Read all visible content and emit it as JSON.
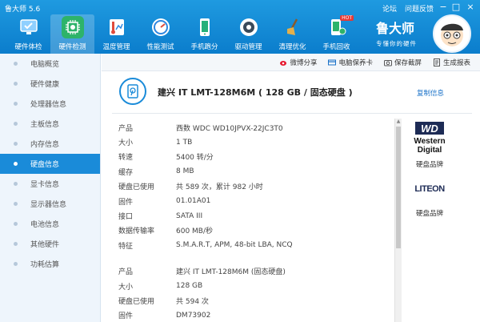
{
  "app": {
    "title": "鲁大师 5.6",
    "links": [
      "论坛",
      "问题反馈"
    ],
    "controls": [
      "−",
      "□",
      "×"
    ]
  },
  "brand": {
    "name": "鲁大师",
    "slogan": "专懂你的硬件"
  },
  "nav": [
    {
      "label": "硬件体检",
      "icon": "monitor-check-icon",
      "color": "#3aa0e8"
    },
    {
      "label": "硬件检测",
      "icon": "chip-icon",
      "color": "#2db36a",
      "active": true
    },
    {
      "label": "温度管理",
      "icon": "thermometer-icon",
      "color": "#e04b3c"
    },
    {
      "label": "性能测试",
      "icon": "speedometer-icon",
      "color": "#2d87e0"
    },
    {
      "label": "手机跑分",
      "icon": "phone-icon",
      "color": "#26b07a"
    },
    {
      "label": "驱动管理",
      "icon": "gear-icon",
      "color": "#3a4a5a"
    },
    {
      "label": "清理优化",
      "icon": "broom-icon",
      "color": "#c98a2a"
    },
    {
      "label": "手机回收",
      "icon": "phone-recycle-icon",
      "color": "#2db36a",
      "badge": "HOT"
    }
  ],
  "sidebar": [
    {
      "label": "电脑概览"
    },
    {
      "label": "硬件健康"
    },
    {
      "label": "处理器信息"
    },
    {
      "label": "主板信息"
    },
    {
      "label": "内存信息"
    },
    {
      "label": "硬盘信息",
      "active": true
    },
    {
      "label": "显卡信息"
    },
    {
      "label": "显示器信息"
    },
    {
      "label": "电池信息"
    },
    {
      "label": "其他硬件"
    },
    {
      "label": "功耗估算"
    }
  ],
  "toolbar": [
    {
      "label": "微博分享",
      "icon": "weibo-icon"
    },
    {
      "label": "电脑保养卡",
      "icon": "card-icon"
    },
    {
      "label": "保存截屏",
      "icon": "camera-icon"
    },
    {
      "label": "生成报表",
      "icon": "report-icon"
    }
  ],
  "header": {
    "title": "建兴 IT LMT-128M6M ( 128 GB / 固态硬盘 )",
    "copy_label": "复制信息",
    "icon": "hard-disk-icon"
  },
  "disk1": [
    {
      "key": "产品",
      "value": "西数 WDC WD10JPVX-22JC3T0"
    },
    {
      "key": "大小",
      "value": "1 TB"
    },
    {
      "key": "转速",
      "value": "5400 转/分"
    },
    {
      "key": "缓存",
      "value": "8 MB"
    },
    {
      "key": "硬盘已使用",
      "value": "共 589 次，累计 982 小时"
    },
    {
      "key": "固件",
      "value": "01.01A01"
    },
    {
      "key": "接口",
      "value": "SATA III"
    },
    {
      "key": "数据传输率",
      "value": "600 MB/秒"
    },
    {
      "key": "特征",
      "value": "S.M.A.R.T,  APM,  48-bit LBA,  NCQ"
    }
  ],
  "disk2": [
    {
      "key": "产品",
      "value": "建兴 IT LMT-128M6M (固态硬盘)"
    },
    {
      "key": "大小",
      "value": "128 GB"
    },
    {
      "key": "硬盘已使用",
      "value": "共 594 次"
    },
    {
      "key": "固件",
      "value": "DM73902"
    }
  ],
  "brands": [
    {
      "logo_text": [
        "Western",
        "Digital"
      ],
      "logo_mark": "WD",
      "caption": "硬盘品牌",
      "icon": "western-digital-logo"
    },
    {
      "logo_text": [
        "LITEON"
      ],
      "caption": "硬盘品牌",
      "icon": "liteon-logo"
    }
  ]
}
